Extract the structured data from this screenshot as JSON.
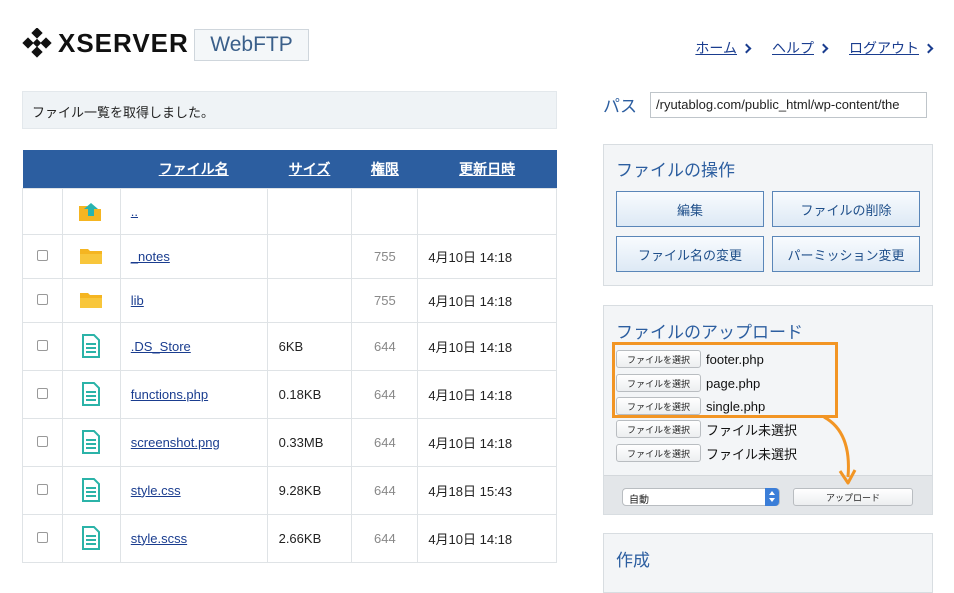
{
  "header": {
    "brand": "XSERVER",
    "product": "WebFTP",
    "nav": [
      {
        "label": "ホーム"
      },
      {
        "label": "ヘルプ"
      },
      {
        "label": "ログアウト"
      }
    ]
  },
  "message": "ファイル一覧を取得しました。",
  "table": {
    "headers": {
      "name": "ファイル名",
      "size": "サイズ",
      "perm": "権限",
      "date": "更新日時"
    },
    "rows": [
      {
        "type": "up",
        "name": "..",
        "size": "",
        "perm": "",
        "date": ""
      },
      {
        "type": "folder",
        "name": "_notes",
        "size": "",
        "perm": "755",
        "date": "4月10日 14:18"
      },
      {
        "type": "folder",
        "name": "lib",
        "size": "",
        "perm": "755",
        "date": "4月10日 14:18"
      },
      {
        "type": "file",
        "name": ".DS_Store",
        "size": "6KB",
        "perm": "644",
        "date": "4月10日 14:18"
      },
      {
        "type": "file",
        "name": "functions.php",
        "size": "0.18KB",
        "perm": "644",
        "date": "4月10日 14:18"
      },
      {
        "type": "file",
        "name": "screenshot.png",
        "size": "0.33MB",
        "perm": "644",
        "date": "4月10日 14:18"
      },
      {
        "type": "file",
        "name": "style.css",
        "size": "9.28KB",
        "perm": "644",
        "date": "4月18日 15:43"
      },
      {
        "type": "file",
        "name": "style.scss",
        "size": "2.66KB",
        "perm": "644",
        "date": "4月10日 14:18"
      }
    ]
  },
  "path": {
    "label": "パス",
    "value": "/ryutablog.com/public_html/wp-content/the"
  },
  "operations": {
    "title": "ファイルの操作",
    "buttons": [
      "編集",
      "ファイルの削除",
      "ファイル名の変更",
      "パーミッション変更"
    ]
  },
  "upload": {
    "title": "ファイルのアップロード",
    "choose_label": "ファイルを選択",
    "files": [
      "footer.php",
      "page.php",
      "single.php",
      "ファイル未選択",
      "ファイル未選択"
    ],
    "mode": "自動",
    "upload_label": "アップロード"
  },
  "create": {
    "title": "作成"
  },
  "colors": {
    "accent": "#2c5ea0",
    "highlight": "#f29524"
  }
}
